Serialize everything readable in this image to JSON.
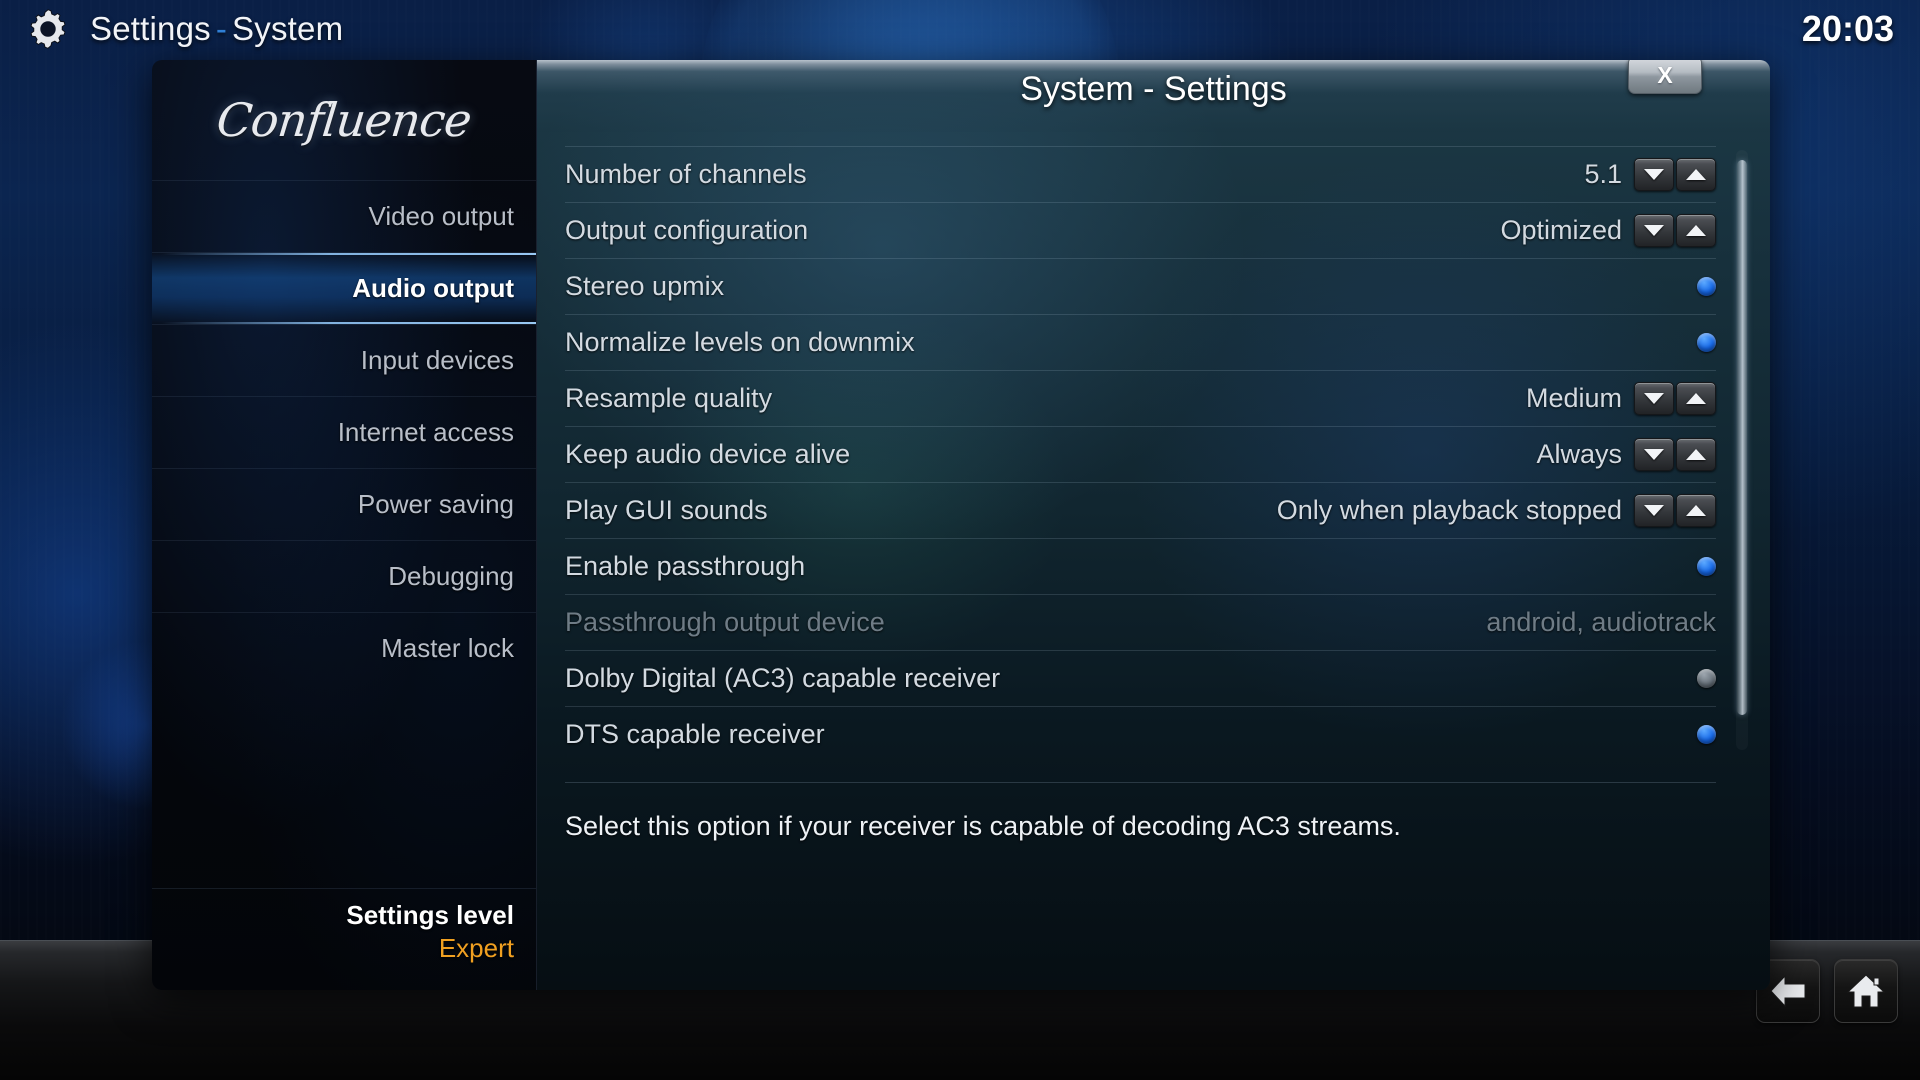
{
  "topbar": {
    "gear_icon": "gear-icon",
    "title_prefix": "Settings",
    "title_separator": "-",
    "title_suffix": "System",
    "clock": "20:03"
  },
  "dialog": {
    "title": "System - Settings",
    "close_label": "X"
  },
  "sidebar": {
    "logo_text": "Confluence",
    "items": [
      {
        "label": "Video output",
        "selected": false
      },
      {
        "label": "Audio output",
        "selected": true
      },
      {
        "label": "Input devices",
        "selected": false
      },
      {
        "label": "Internet access",
        "selected": false
      },
      {
        "label": "Power saving",
        "selected": false
      },
      {
        "label": "Debugging",
        "selected": false
      },
      {
        "label": "Master lock",
        "selected": false
      }
    ],
    "settings_level_label": "Settings level",
    "settings_level_value": "Expert",
    "settings_level_color": "#f0a021"
  },
  "settings": {
    "rows": [
      {
        "label": "Number of channels",
        "value": "5.1",
        "control": "spinner",
        "disabled": false
      },
      {
        "label": "Output configuration",
        "value": "Optimized",
        "control": "spinner",
        "disabled": false
      },
      {
        "label": "Stereo upmix",
        "value": "",
        "control": "radio-on",
        "disabled": false
      },
      {
        "label": "Normalize levels on downmix",
        "value": "",
        "control": "radio-on",
        "disabled": false
      },
      {
        "label": "Resample quality",
        "value": "Medium",
        "control": "spinner",
        "disabled": false
      },
      {
        "label": "Keep audio device alive",
        "value": "Always",
        "control": "spinner",
        "disabled": false
      },
      {
        "label": "Play GUI sounds",
        "value": "Only when playback stopped",
        "control": "spinner",
        "disabled": false
      },
      {
        "label": "Enable passthrough",
        "value": "",
        "control": "radio-on",
        "disabled": false
      },
      {
        "label": "Passthrough output device",
        "value": "android, audiotrack",
        "control": "none",
        "disabled": true
      },
      {
        "label": "Dolby Digital (AC3) capable receiver",
        "value": "",
        "control": "radio-off",
        "disabled": false
      },
      {
        "label": "DTS capable receiver",
        "value": "",
        "control": "radio-on",
        "disabled": false
      }
    ],
    "description": "Select this option if your receiver is capable of decoding AC3 streams."
  },
  "navigation": {
    "back_icon": "back-arrow-icon",
    "home_icon": "home-icon"
  },
  "colors": {
    "accent_blue": "#1668e8",
    "expert_orange": "#f0a021",
    "text_primary": "#d3dae1"
  }
}
